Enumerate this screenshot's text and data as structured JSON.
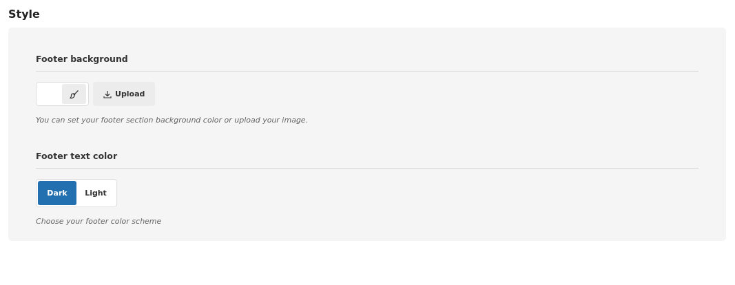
{
  "title": "Style",
  "sections": [
    {
      "kind": "background",
      "heading": "Footer background",
      "color": "#ffffff",
      "upload_label": "Upload",
      "help": "You can set your footer section background color or upload your image."
    },
    {
      "kind": "scheme",
      "heading": "Footer text color",
      "options": [
        {
          "label": "Dark",
          "selected": true
        },
        {
          "label": "Light",
          "selected": false
        }
      ],
      "help": "Choose your footer color scheme"
    }
  ]
}
